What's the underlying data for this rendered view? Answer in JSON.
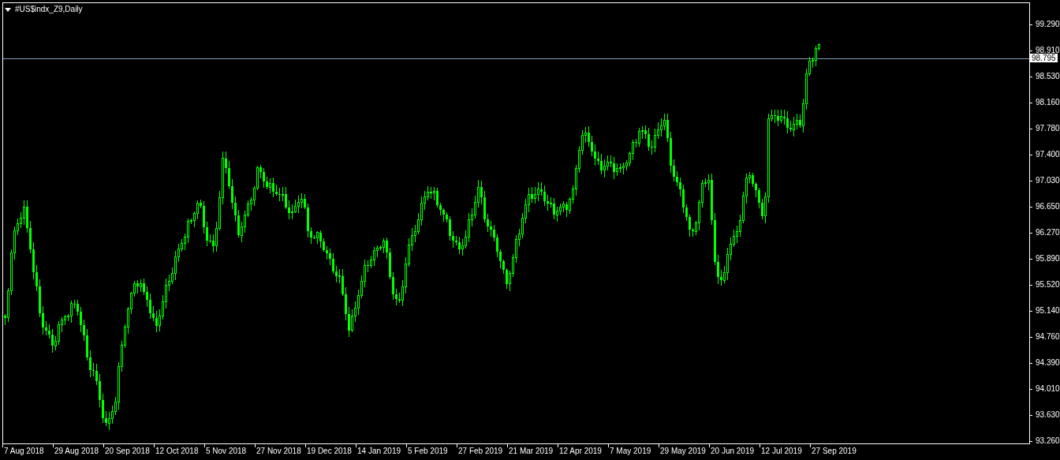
{
  "chart": {
    "title": "#US$indx_Z9,Daily",
    "current_price": "98.795"
  },
  "price_axis": {
    "labels": [
      "99.290",
      "98.910",
      "98.530",
      "98.160",
      "97.780",
      "97.400",
      "97.030",
      "96.650",
      "96.270",
      "95.890",
      "95.520",
      "95.140",
      "94.760",
      "94.390",
      "94.010",
      "93.630",
      "93.260"
    ]
  },
  "time_axis": {
    "labels": [
      "7 Aug 2018",
      "29 Aug 2018",
      "20 Sep 2018",
      "12 Oct 2018",
      "5 Nov 2018",
      "27 Nov 2018",
      "19 Dec 2018",
      "14 Jan 2019",
      "5 Feb 2019",
      "27 Feb 2019",
      "21 Mar 2019",
      "12 Apr 2019",
      "7 May 2019",
      "29 May 2019",
      "20 Jun 2019",
      "12 Jul 2019",
      "27 Sep 2019"
    ]
  }
}
